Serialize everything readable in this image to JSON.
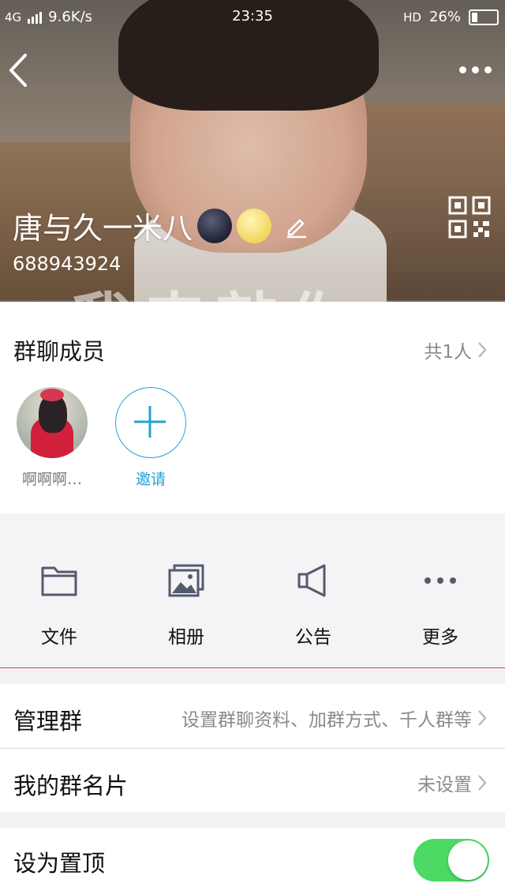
{
  "status_bar": {
    "network": "4G",
    "speed": "9.6K/s",
    "time": "23:35",
    "hd": "HD",
    "battery_percent": "26%",
    "battery_level": 0.26
  },
  "header": {
    "group_name": "唐与久一米八",
    "group_id": "688943924",
    "overlay_text": "我来敲你"
  },
  "members": {
    "title": "群聊成员",
    "count": "共1人",
    "list": [
      {
        "name": "啊啊啊…"
      }
    ],
    "invite_label": "邀请"
  },
  "shortcuts": [
    {
      "label": "文件",
      "icon": "folder-icon"
    },
    {
      "label": "相册",
      "icon": "album-icon"
    },
    {
      "label": "公告",
      "icon": "announcement-icon"
    },
    {
      "label": "更多",
      "icon": "more-dots-icon"
    }
  ],
  "settings": {
    "manage": {
      "title": "管理群",
      "value": "设置群聊资料、加群方式、千人群等"
    },
    "card": {
      "title": "我的群名片",
      "value": "未设置"
    },
    "pin": {
      "title": "设为置顶",
      "enabled": true
    }
  },
  "colors": {
    "accent": "#1fa0d6",
    "toggle_on": "#4cd964"
  }
}
